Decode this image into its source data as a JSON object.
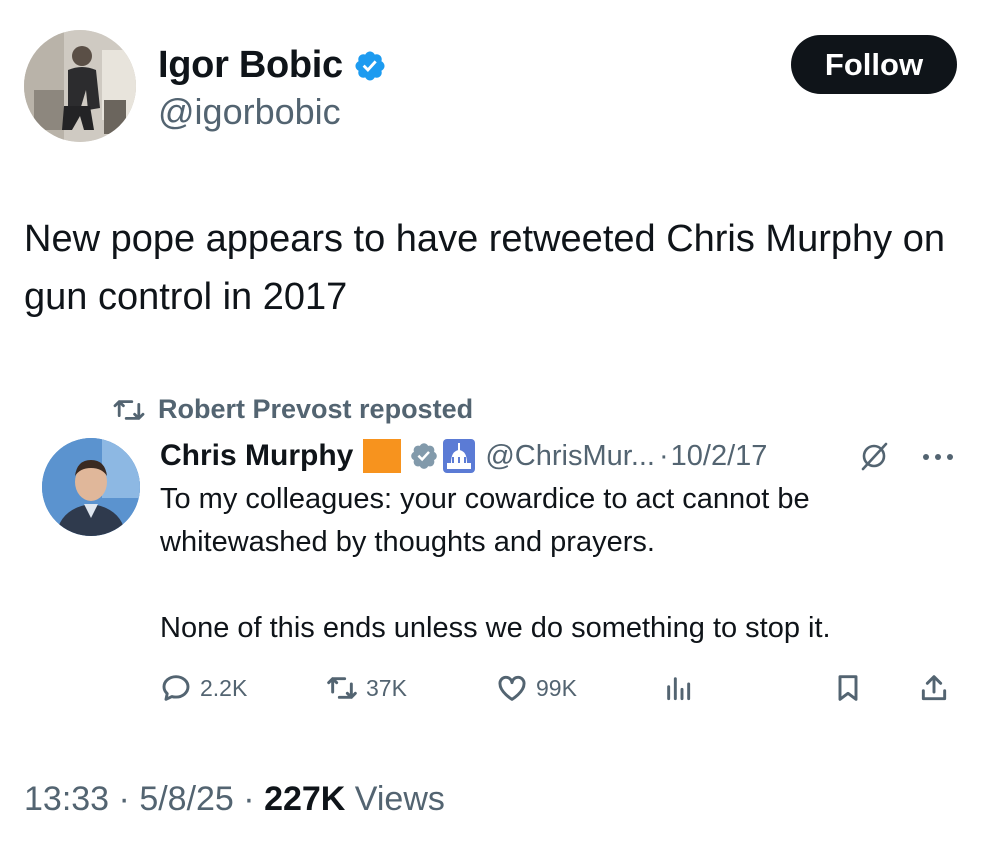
{
  "author": {
    "name": "Igor Bobic",
    "handle": "@igorbobic",
    "verified": true
  },
  "follow_button": {
    "label": "Follow"
  },
  "tweet": {
    "text": "New pope appears to have retweeted Chris Murphy on gun control in 2017"
  },
  "embedded": {
    "repost_label": "Robert Prevost reposted",
    "name": "Chris Murphy",
    "handle": "@ChrisMur...",
    "separator": "·",
    "date": "10/2/17",
    "text_paragraph_1": "To my colleagues: your cowardice to act cannot be whitewashed by thoughts and prayers.",
    "text_paragraph_2": "None of this ends unless we do something to stop it.",
    "actions": {
      "replies": "2.2K",
      "reposts": "37K",
      "likes": "99K"
    }
  },
  "meta": {
    "time": "13:33",
    "sep1": " · ",
    "date": "5/8/25",
    "sep2": " · ",
    "views_count": "227K",
    "views_label": " Views"
  },
  "colors": {
    "verified_blue": "#1d9bf0",
    "text_primary": "#0f1419",
    "text_secondary": "#536471",
    "emoji_orange": "#f7931e"
  },
  "icons": [
    "verified-badge-icon",
    "repost-icon",
    "orange-square-emoji",
    "gov-badge-icon",
    "capitol-emoji-icon",
    "grok-icon",
    "more-icon",
    "reply-icon",
    "retweet-icon",
    "like-icon",
    "views-icon",
    "bookmark-icon",
    "share-icon"
  ]
}
